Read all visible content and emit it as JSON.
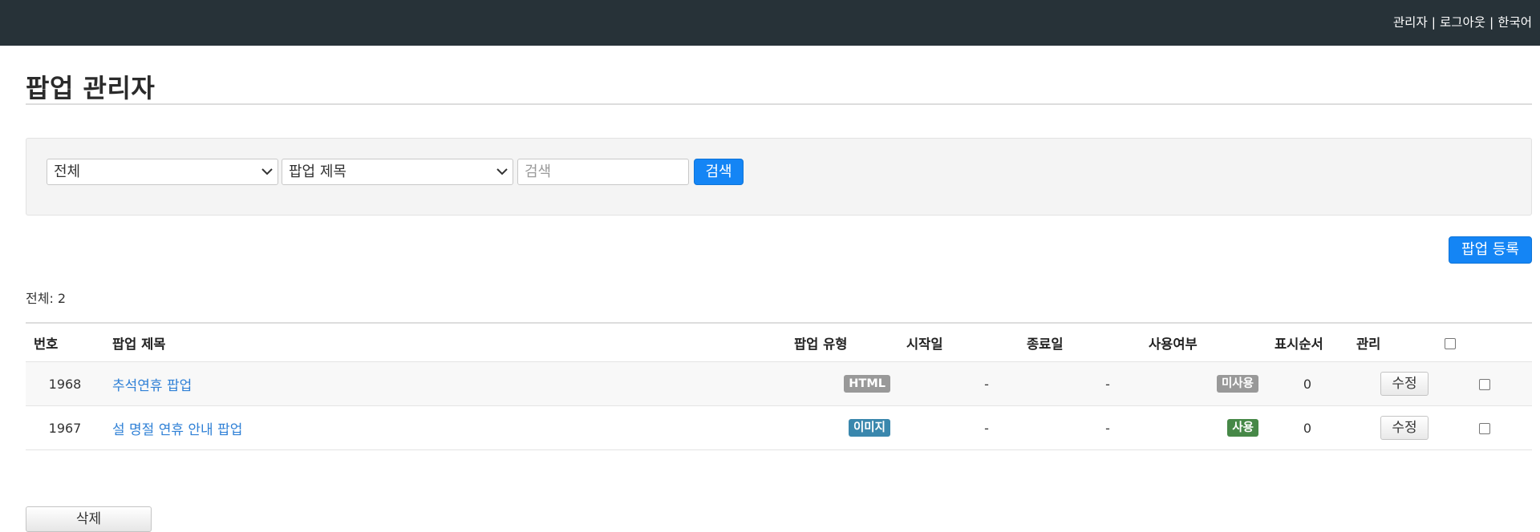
{
  "topnav": {
    "admin": "관리자",
    "logout": "로그아웃",
    "language": "한국어",
    "separator": "|"
  },
  "page_title": "팝업 관리자",
  "search": {
    "category_value": "전체",
    "field_value": "팝업 제목",
    "keyword_placeholder": "검색",
    "keyword_value": "",
    "search_button": "검색"
  },
  "register_button": "팝업 등록",
  "total_text": "전체: 2",
  "table": {
    "headers": {
      "number": "번호",
      "title": "팝업 제목",
      "type": "팝업 유형",
      "start": "시작일",
      "end": "종료일",
      "status": "사용여부",
      "order": "표시순서",
      "manage": "관리"
    },
    "rows": [
      {
        "number": "1968",
        "title": "추석연휴 팝업",
        "type": "HTML",
        "type_color": "#999999",
        "start": "-",
        "end": "-",
        "status": "미사용",
        "status_color": "#999999",
        "order": "0",
        "edit": "수정"
      },
      {
        "number": "1967",
        "title": "설 명절 연휴 안내 팝업",
        "type": "이미지",
        "type_color": "#3a87ad",
        "start": "-",
        "end": "-",
        "status": "사용",
        "status_color": "#468847",
        "order": "0",
        "edit": "수정"
      }
    ]
  },
  "delete_button": "삭제",
  "colors": {
    "topbar": "#273238",
    "primary": "#1485f5",
    "link": "#2f80d6"
  }
}
